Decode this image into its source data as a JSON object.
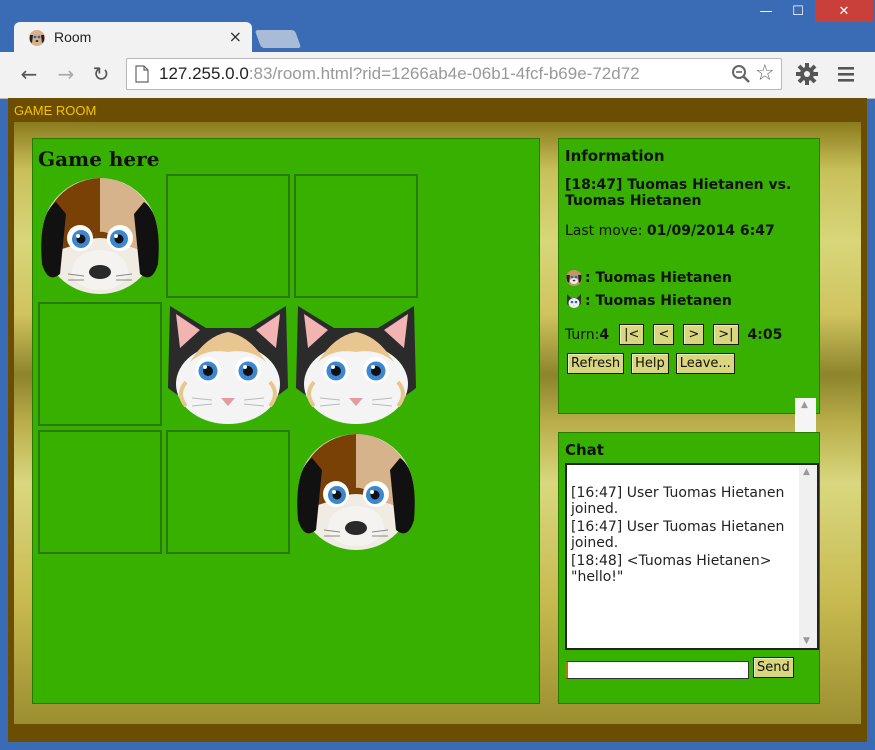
{
  "browser": {
    "tab_title": "Room",
    "tab_close": "×",
    "window_controls": {
      "minimize": "—",
      "maximize": "☐",
      "close": "✕"
    },
    "url_host": "127.255.0.0",
    "url_rest": ":83/room.html?rid=1266ab4e-06b1-4fcf-b69e-72d72"
  },
  "page": {
    "header": "GAME ROOM"
  },
  "game": {
    "title": "Game here",
    "board": [
      [
        "dog",
        "",
        ""
      ],
      [
        "",
        "cat",
        "cat"
      ],
      [
        "",
        "",
        "dog"
      ]
    ]
  },
  "info": {
    "title": "Information",
    "match": "[18:47] Tuomas Hietanen vs. Tuomas Hietanen",
    "last_move_label": "Last move: ",
    "last_move_value": "01/09/2014 6:47",
    "player1": ": Tuomas Hietanen",
    "player2": ": Tuomas Hietanen",
    "turn_label": "Turn: ",
    "turn_value": "4",
    "first_btn": "|<",
    "prev_btn": "<",
    "next_btn": ">",
    "last_btn": ">|",
    "timer": "4:05",
    "refresh": "Refresh",
    "help": "Help",
    "leave": "Leave..."
  },
  "chat": {
    "title": "Chat",
    "messages": [
      "[16:47] User Tuomas Hietanen joined.",
      "[16:47] User Tuomas Hietanen joined.",
      "[18:48] <Tuomas Hietanen> \"hello!\""
    ],
    "input_value": "",
    "send": "Send"
  },
  "colors": {
    "panel_green": "#38b000",
    "page_brown": "#6b4e03",
    "header_yellow": "#f3c400",
    "button_bg": "#d9d67e"
  }
}
